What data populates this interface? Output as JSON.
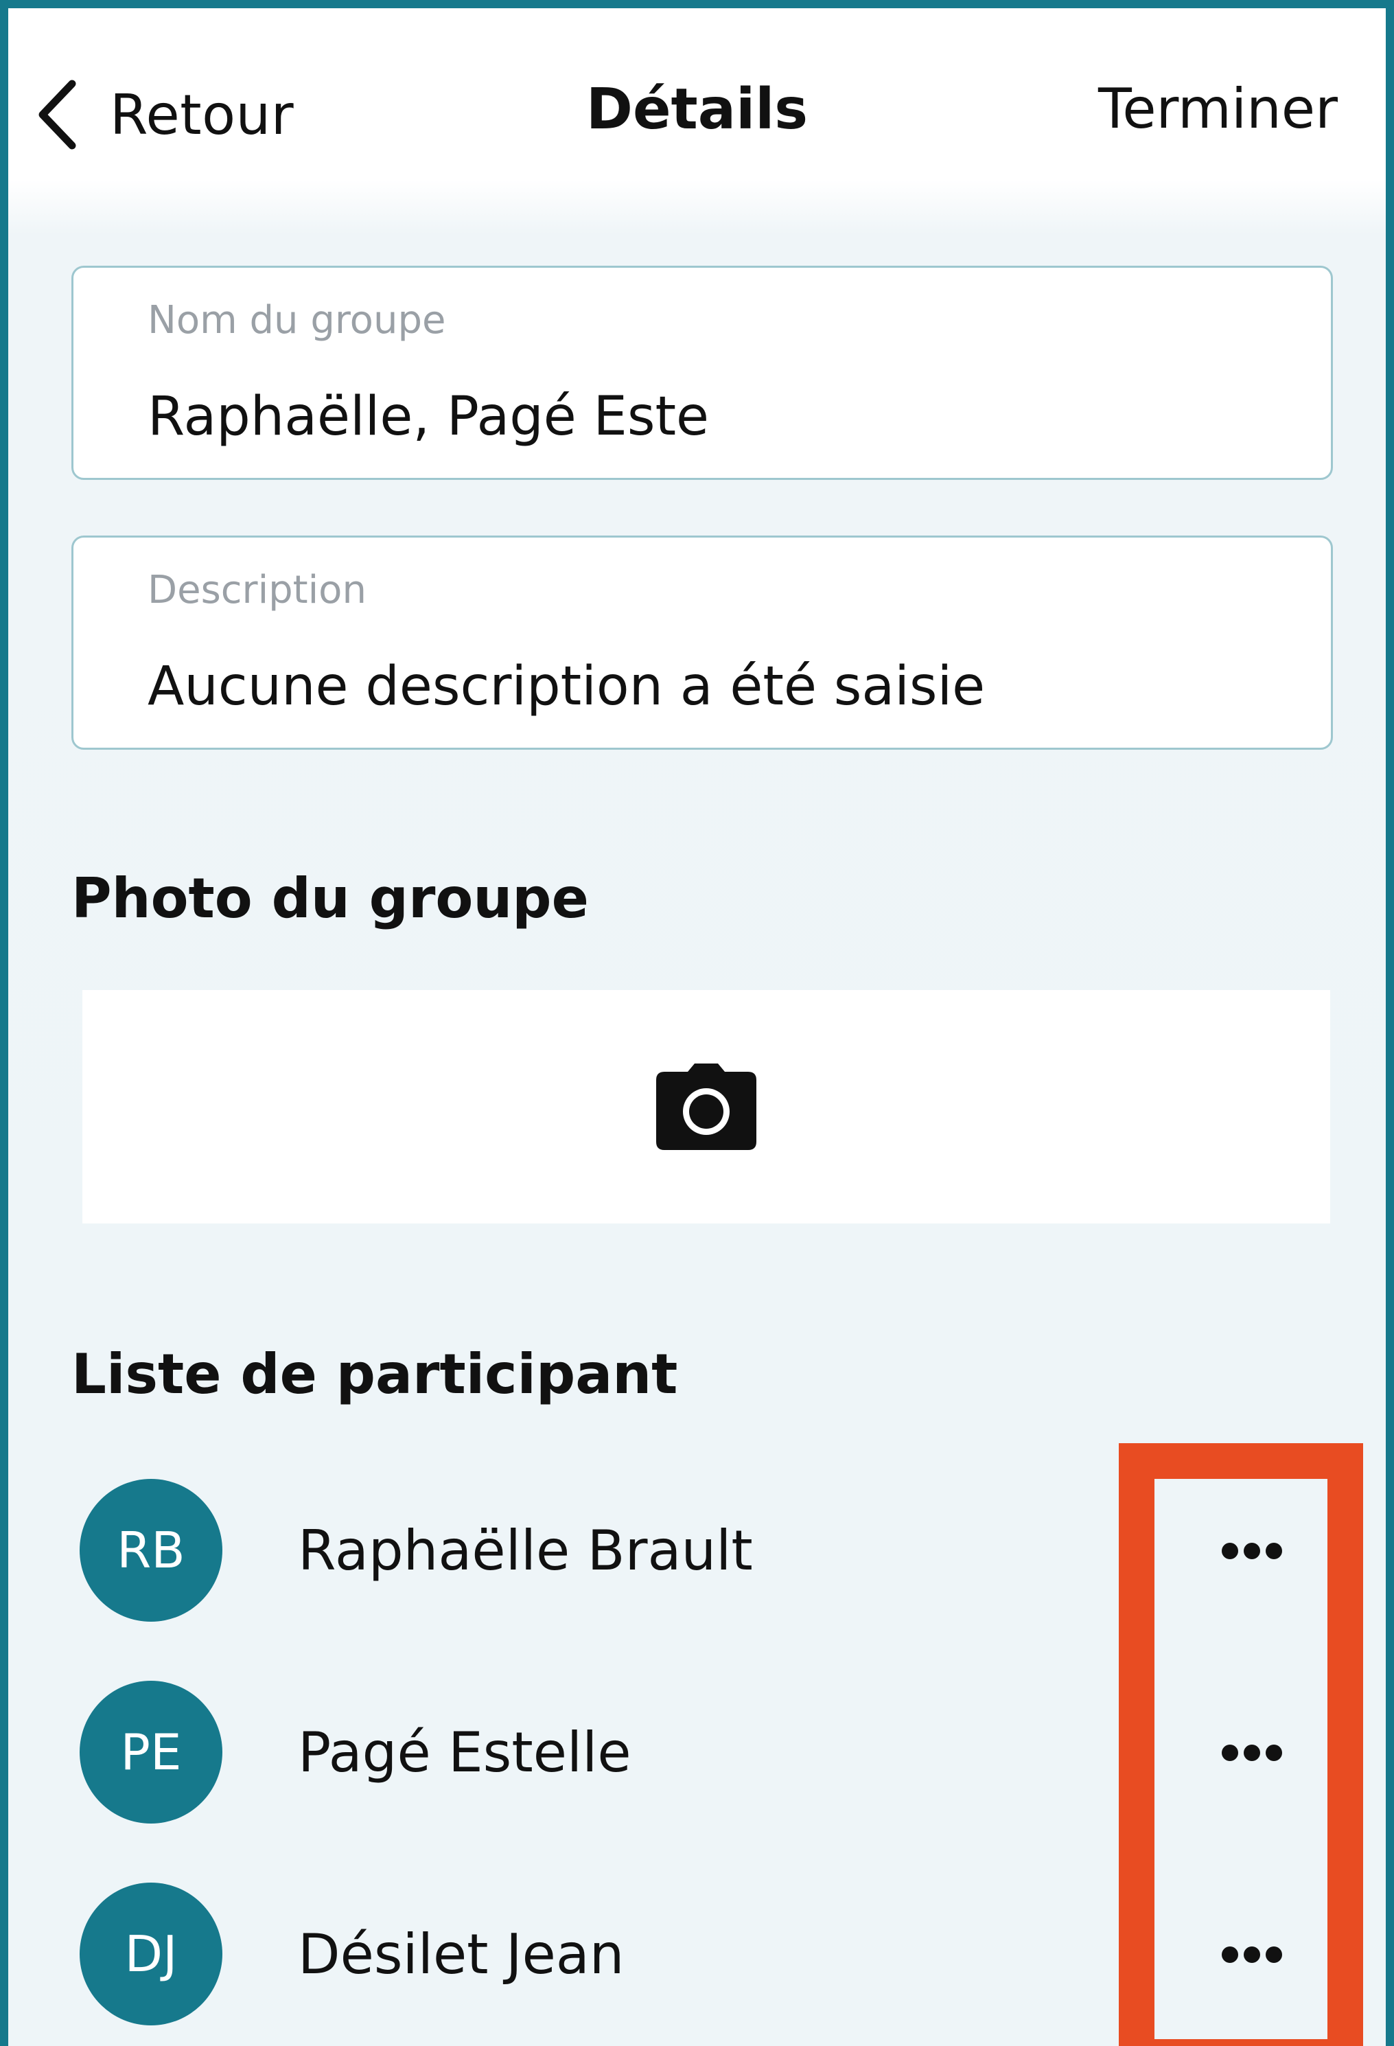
{
  "nav": {
    "back_label": "Retour",
    "title": "Détails",
    "done_label": "Terminer"
  },
  "fields": {
    "group_name": {
      "label": "Nom du groupe",
      "value": "Raphaëlle, Pagé Este"
    },
    "description": {
      "label": "Description",
      "value": "Aucune description a été saisie"
    }
  },
  "photo_section": {
    "title": "Photo du groupe",
    "icon": "camera-icon"
  },
  "participants_section": {
    "title": "Liste de participant",
    "participants": [
      {
        "initials": "RB",
        "name": "Raphaëlle Brault"
      },
      {
        "initials": "PE",
        "name": "Pagé Estelle"
      },
      {
        "initials": "DJ",
        "name": "Désilet Jean"
      }
    ]
  },
  "icons": {
    "back": "chevron-left-icon",
    "more": "more-horizontal-icon"
  },
  "colors": {
    "accent": "#16798c",
    "highlight": "#e84c22",
    "background": "#eef5f8",
    "field_border": "#9ec7cf"
  }
}
